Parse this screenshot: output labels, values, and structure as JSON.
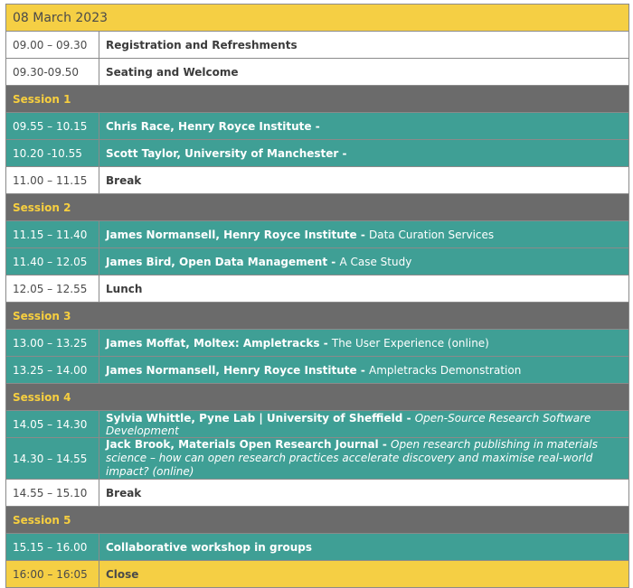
{
  "date": "08 March 2023",
  "rows": [
    {
      "type": "white",
      "time": "09.00 – 09.30",
      "speaker": "Registration and Refreshments",
      "sep": "",
      "talk": ""
    },
    {
      "type": "white",
      "time": "09.30-09.50",
      "speaker": "Seating and Welcome",
      "sep": "",
      "talk": ""
    },
    {
      "type": "session",
      "label": "Session 1"
    },
    {
      "type": "teal",
      "time": "09.55 – 10.15",
      "speaker": "Chris Race, Henry Royce Institute -",
      "sep": "",
      "talk": ""
    },
    {
      "type": "teal",
      "time": "10.20 -10.55",
      "speaker": "Scott Taylor, University of Manchester -",
      "sep": "",
      "talk": ""
    },
    {
      "type": "white",
      "time": "11.00 – 11.15",
      "speaker": "Break",
      "sep": "",
      "talk": ""
    },
    {
      "type": "session",
      "label": "Session 2"
    },
    {
      "type": "teal",
      "time": "11.15 – 11.40",
      "speaker": "James Normansell, Henry Royce Institute",
      "sep": " - ",
      "talk": "Data Curation Services"
    },
    {
      "type": "teal",
      "time": "11.40 – 12.05",
      "speaker": "James Bird, Open Data Management",
      "sep": " - ",
      "talk": "A Case Study"
    },
    {
      "type": "white",
      "time": "12.05 – 12.55",
      "speaker": "Lunch",
      "sep": "",
      "talk": ""
    },
    {
      "type": "session",
      "label": "Session 3"
    },
    {
      "type": "teal",
      "time": "13.00 – 13.25",
      "speaker": "James Moffat, Moltex:  Ampletracks",
      "sep": " - ",
      "talk": "The User Experience (online)"
    },
    {
      "type": "teal",
      "time": "13.25 – 14.00",
      "speaker": "James Normansell, Henry Royce Institute",
      "sep": " - ",
      "talk": "Ampletracks Demonstration"
    },
    {
      "type": "session",
      "label": "Session 4"
    },
    {
      "type": "teal",
      "time": "14.05 – 14.30",
      "speaker": "Sylvia Whittle, Pyne Lab | University of Sheffield",
      "sep": " - ",
      "talk": "Open-Source Research Software Development",
      "italic": true
    },
    {
      "type": "teal",
      "tall": true,
      "time": "14.30 – 14.55",
      "speaker": "Jack Brook, Materials Open Research Journal",
      "sep": " - ",
      "talk": "Open research publishing in materials science – how can open research practices accelerate discovery and maximise real-world impact? (online)",
      "italic": true
    },
    {
      "type": "white",
      "time": "14.55 – 15.10",
      "speaker": "Break",
      "sep": "",
      "talk": ""
    },
    {
      "type": "session",
      "label": "Session 5"
    },
    {
      "type": "teal",
      "time": "15.15 – 16.00",
      "speaker": "Collaborative workshop in groups",
      "sep": "",
      "talk": ""
    },
    {
      "type": "close",
      "time": "16:00 – 16:05",
      "speaker": "Close",
      "sep": "",
      "talk": ""
    }
  ]
}
